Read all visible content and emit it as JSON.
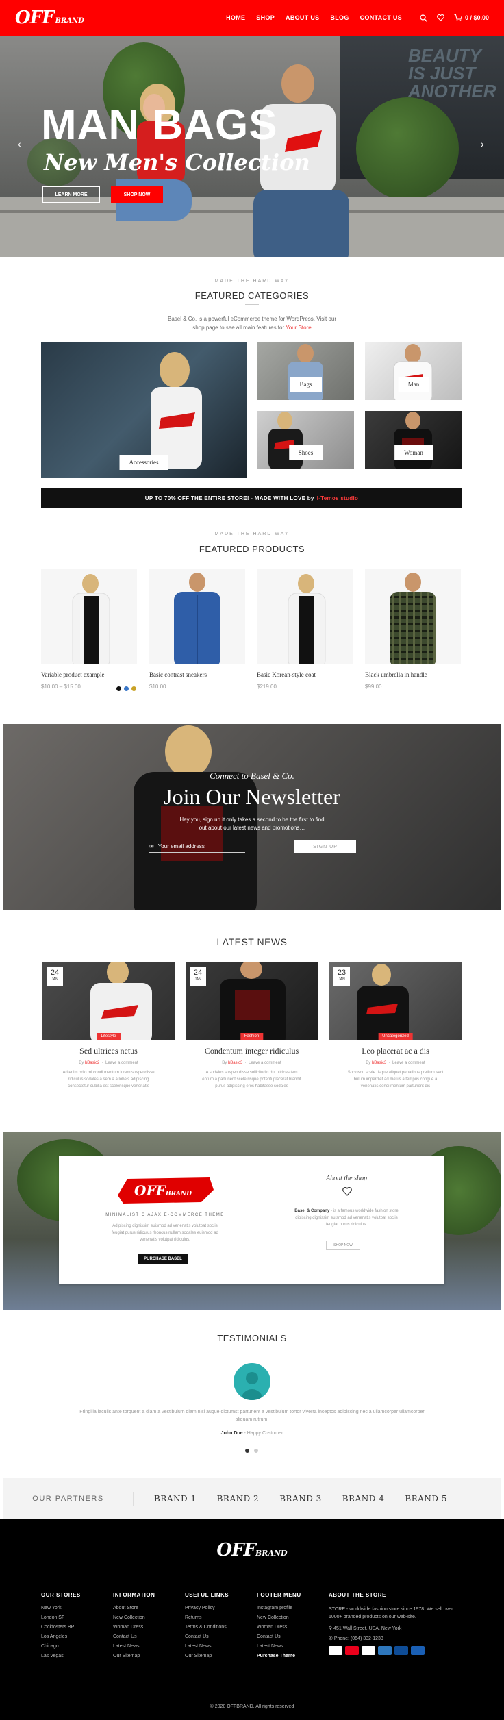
{
  "header": {
    "logo_main": "OFF",
    "logo_sub": "BRAND",
    "nav": [
      "HOME",
      "SHOP",
      "ABOUT US",
      "BLOG",
      "CONTACT US"
    ],
    "cart_label": "0 / $0.00",
    "colors": {
      "brand": "#ff0000"
    }
  },
  "hero": {
    "title": "MAN BAGS",
    "subtitle": "New Men's Collection",
    "btn_learn": "LEARN MORE",
    "btn_shop": "SHOP NOW",
    "building_text": "BEAUTY IS JUST ANOTHER"
  },
  "categories": {
    "eyebrow": "MADE THE HARD WAY",
    "title": "FEATURED CATEGORIES",
    "desc_1": "Basel & Co. is a powerful eCommerce theme for WordPress. Visit our",
    "desc_2": "shop page to see all main features for",
    "desc_link": "Your Store",
    "items": [
      "Accessories",
      "Bags",
      "Man",
      "Shoes",
      "Woman"
    ]
  },
  "promo": {
    "text": "UP TO 70% OFF THE ENTIRE STORE! - MADE WITH LOVE by",
    "link": "I-Temos studio"
  },
  "products": {
    "eyebrow": "MADE THE HARD WAY",
    "title": "FEATURED PRODUCTS",
    "items": [
      {
        "name": "Variable product example",
        "price": "$10.00 – $15.00"
      },
      {
        "name": "Basic contrast sneakers",
        "price": "$10.00"
      },
      {
        "name": "Basic Korean-style coat",
        "price": "$219.00"
      },
      {
        "name": "Black umbrella in handle",
        "price": "$99.00"
      }
    ],
    "swatch_colors": [
      "#111111",
      "#3c78c8",
      "#c9a227"
    ]
  },
  "newsletter": {
    "small": "Connect to Basel & Co.",
    "title": "Join Our Newsletter",
    "desc_1": "Hey you, sign up it only takes a second to be the first to find",
    "desc_2": "out about our latest news and promotions…",
    "placeholder": "Your email address",
    "button": "SIGN UP"
  },
  "news": {
    "title": "LATEST NEWS",
    "items": [
      {
        "day": "24",
        "month": "JAN",
        "tag": "Lifestyle",
        "title": "Sed ultrices netus",
        "author_pre": "By",
        "author": "bBasic2",
        "comment": "Leave a comment",
        "ex1": "Ad enim odio mi condi mentum lorem suspendisse",
        "ex2": "ridiculus sodales a sem a a lobels adipiscing",
        "ex3": "consectetur cubilia est scelerisque venenatis"
      },
      {
        "day": "24",
        "month": "JAN",
        "tag": "Fashion",
        "title": "Condentum integer ridiculus",
        "author_pre": "By",
        "author": "bBasic3",
        "comment": "Leave a comment",
        "ex1": "A sodales suspen disse sollicitudin dui ultrices tem",
        "ex2": "entum a parturient scele risque potenti placerat blandit",
        "ex3": "purus adipiscing eros habitasse sodales"
      },
      {
        "day": "23",
        "month": "JAN",
        "tag": "Uncategorized",
        "title": "Leo placerat ac a dis",
        "author_pre": "By",
        "author": "bBasic3",
        "comment": "Leave a comment",
        "ex1": "Sociosqu scele risque aliquet penatibus pretium sect",
        "ex2": "bulum imperdiet ad metus a tempus congue a",
        "ex3": "venenatis condi mentum parturient dis"
      }
    ]
  },
  "about": {
    "logo": "OFFBRAND",
    "tagline": "MINIMALISTIC AJAX E-COMMERCE THEME",
    "desc_1": "Adipiscing dignissim euismod ad venenatis volutpat sociis",
    "desc_2": "feugiat purus ridiculus rhoncus nullam sodales euismod ad",
    "desc_3": "venenatis volutpat ridiculus.",
    "button": "PURCHASE BASEL",
    "right_title": "About the shop",
    "right_bold": "Basel & Company",
    "right_desc_1": " - is a famous worldwide fashion store",
    "right_desc_2": "dipiscing dignissim euismod ad venenatis volutpat sociis",
    "right_desc_3": "feugiat purus ridiculus.",
    "right_button": "SHOP NOW"
  },
  "testimonials": {
    "title": "TESTIMONIALS",
    "text_1": "Fringilla iaculis ante torquent a diam a vestibulum diam nisi augue dictumst parturient a vestibulum tortor viverra inceptos adipiscing nec a ullamcorper ullamcorper",
    "text_2": "aliquam rutrum.",
    "author": "John Doe",
    "role": " - Happy Customer"
  },
  "partners": {
    "title": "OUR PARTNERS",
    "brands": [
      "BRAND 1",
      "BRAND 2",
      "BRAND 3",
      "BRAND 4",
      "BRAND 5"
    ]
  },
  "footer": {
    "logo_main": "OFF",
    "logo_sub": "BRAND",
    "col1": {
      "title": "OUR STORES",
      "items": [
        "New York",
        "London SF",
        "Cockfosters BP",
        "Los Angeles",
        "Chicago",
        "Las Vegas"
      ]
    },
    "col2": {
      "title": "INFORMATION",
      "items": [
        "About Store",
        "New Collection",
        "Woman Dress",
        "Contact Us",
        "Latest News",
        "Our Sitemap"
      ]
    },
    "col3": {
      "title": "USEFUL LINKS",
      "items": [
        "Privacy Policy",
        "Returns",
        "Terms & Conditions",
        "Contact Us",
        "Latest News",
        "Our Sitemap"
      ]
    },
    "col4": {
      "title": "FOOTER MENU",
      "items": [
        "Instagram profile",
        "New Collection",
        "Woman Dress",
        "Contact Us",
        "Latest News",
        "Purchase Theme"
      ]
    },
    "col5": {
      "title": "ABOUT THE STORE",
      "text_1": "STORE - worldwide fashion store since 1978. We sell over",
      "text_2": "1000+ branded products on our web-site.",
      "address": "451 Wall Street, USA, New York",
      "phone": "Phone: (064) 332-1233"
    },
    "copyright": "© 2020 OFFBRAND. All rights reserved"
  }
}
